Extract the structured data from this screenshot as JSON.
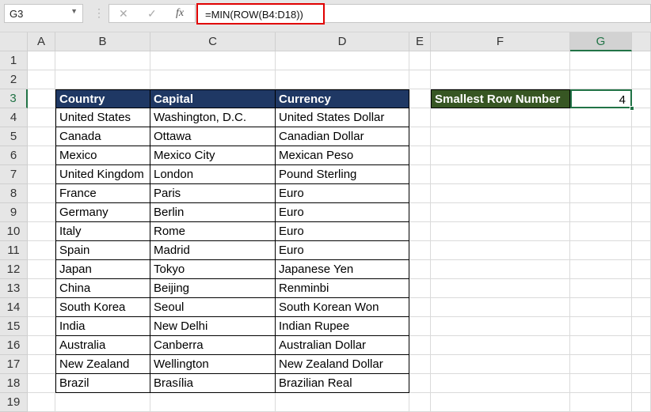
{
  "name_box": "G3",
  "formula": "=MIN(ROW(B4:D18))",
  "icons": {
    "cancel": "✕",
    "enter": "✓",
    "fx": "fx"
  },
  "columns": [
    "A",
    "B",
    "C",
    "D",
    "E",
    "F",
    "G"
  ],
  "selected_column": "G",
  "selected_row": 3,
  "row_numbers": [
    "1",
    "2",
    "3",
    "4",
    "5",
    "6",
    "7",
    "8",
    "9",
    "10",
    "11",
    "12",
    "13",
    "14",
    "15",
    "16",
    "17",
    "18",
    "19"
  ],
  "table": {
    "headers": [
      "Country",
      "Capital",
      "Currency"
    ],
    "rows": [
      [
        "United States",
        "Washington, D.C.",
        "United States Dollar"
      ],
      [
        "Canada",
        "Ottawa",
        "Canadian Dollar"
      ],
      [
        "Mexico",
        "Mexico City",
        "Mexican Peso"
      ],
      [
        "United Kingdom",
        "London",
        "Pound Sterling"
      ],
      [
        "France",
        "Paris",
        "Euro"
      ],
      [
        "Germany",
        "Berlin",
        "Euro"
      ],
      [
        "Italy",
        "Rome",
        "Euro"
      ],
      [
        "Spain",
        "Madrid",
        "Euro"
      ],
      [
        "Japan",
        "Tokyo",
        "Japanese Yen"
      ],
      [
        "China",
        "Beijing",
        "Renminbi"
      ],
      [
        "South Korea",
        "Seoul",
        "South Korean Won"
      ],
      [
        "India",
        "New Delhi",
        "Indian Rupee"
      ],
      [
        "Australia",
        "Canberra",
        "Australian Dollar"
      ],
      [
        "New Zealand",
        "Wellington",
        "New Zealand Dollar"
      ],
      [
        "Brazil",
        "Brasília",
        "Brazilian Real"
      ]
    ]
  },
  "result": {
    "label": "Smallest Row Number",
    "value": "4"
  },
  "colors": {
    "header_fill": "#1f3864",
    "label_fill": "#375623",
    "selection": "#217346",
    "formula_highlight": "#e00000"
  }
}
